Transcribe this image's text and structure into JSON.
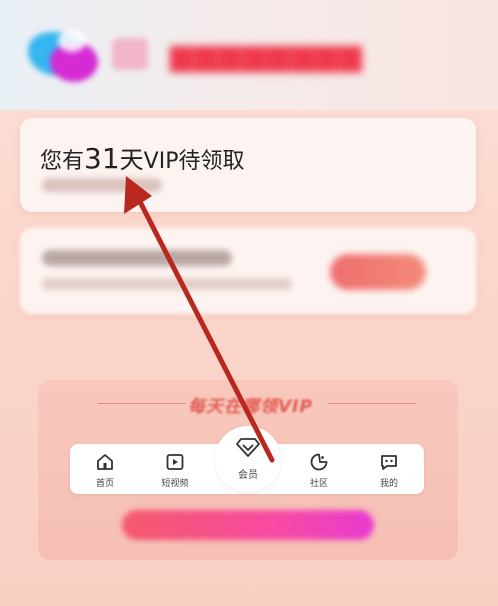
{
  "card1": {
    "prefix": "您有",
    "days": "31",
    "middle": "天",
    "suffix": "VIP待领取"
  },
  "promo": {
    "title": "每天在哪领VIP"
  },
  "tabbar": {
    "tabs": [
      {
        "label": "首页",
        "icon": "home-icon"
      },
      {
        "label": "短视频",
        "icon": "video-icon"
      },
      {
        "label": "会员",
        "icon": "diamond-icon"
      },
      {
        "label": "社区",
        "icon": "community-icon"
      },
      {
        "label": "我的",
        "icon": "profile-icon"
      }
    ]
  },
  "colors": {
    "accent": "#e25c55",
    "annotation_arrow": "#b8281e",
    "cta_gradient_start": "#f55a6a",
    "cta_gradient_end": "#e83bd0"
  }
}
